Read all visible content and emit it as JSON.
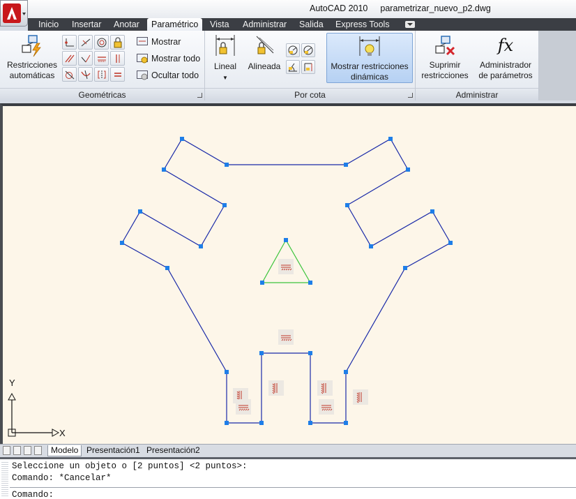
{
  "titlebar": {
    "app_name": "AutoCAD 2010",
    "file_name": "parametrizar_nuevo_p2.dwg"
  },
  "tabs": [
    {
      "label": "Inicio",
      "active": false
    },
    {
      "label": "Insertar",
      "active": false
    },
    {
      "label": "Anotar",
      "active": false
    },
    {
      "label": "Paramétrico",
      "active": true
    },
    {
      "label": "Vista",
      "active": false
    },
    {
      "label": "Administrar",
      "active": false
    },
    {
      "label": "Salida",
      "active": false
    },
    {
      "label": "Express Tools",
      "active": false
    }
  ],
  "ribbon": {
    "geometricas": {
      "title": "Geométricas",
      "auto_label_1": "Restricciones",
      "auto_label_2": "automáticas",
      "show_label": "Mostrar",
      "show_all_label": "Mostrar todo",
      "hide_all_label": "Ocultar todo"
    },
    "porcota": {
      "title": "Por cota",
      "linear_label": "Lineal",
      "aligned_label": "Alineada",
      "dynamic_label_1": "Mostrar restricciones",
      "dynamic_label_2": "dinámicas"
    },
    "administrar": {
      "title": "Administrar",
      "delete_label_1": "Suprimir",
      "delete_label_2": "restricciones",
      "params_label_1": "Administrador",
      "params_label_2": "de parámetros",
      "fx_label": "fx"
    }
  },
  "drawing": {
    "axis_x_label": "X",
    "axis_y_label": "Y",
    "colors": {
      "background": "#fdf6e9",
      "shape_line": "#1a2aa8",
      "triangle_line": "#3cc43c",
      "grip": "#1e7ee8",
      "constraint_icon": "#c0392b"
    }
  },
  "layout_tabs": [
    {
      "label": "Modelo",
      "active": true
    },
    {
      "label": "Presentación1",
      "active": false
    },
    {
      "label": "Presentación2",
      "active": false
    }
  ],
  "command": {
    "line1": "Seleccione un objeto o [2 puntos] <2 puntos>:",
    "line2": "Comando: *Cancelar*",
    "prompt": "Comando:"
  }
}
